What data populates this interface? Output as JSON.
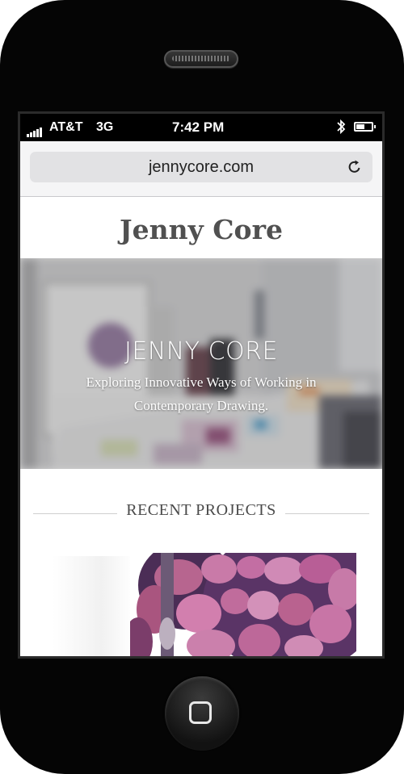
{
  "status_bar": {
    "carrier": "AT&T",
    "network": "3G",
    "time": "7:42 PM",
    "battery_level": 0.55,
    "signal_bars": 5
  },
  "browser": {
    "url": "jennycore.com"
  },
  "site": {
    "title": "Jenny Core"
  },
  "hero": {
    "heading": "JENNY CORE",
    "subtitle": "Exploring Innovative Ways of Working in Contemporary Drawing."
  },
  "sections": {
    "recent_projects": "RECENT PROJECTS"
  },
  "colors": {
    "title_text": "#505050",
    "project_art_primary": "#c36ea3",
    "project_art_shadow": "#4b2d56"
  },
  "icons": [
    "signal-icon",
    "bluetooth-icon",
    "battery-icon",
    "reload-icon",
    "home-button-icon"
  ]
}
